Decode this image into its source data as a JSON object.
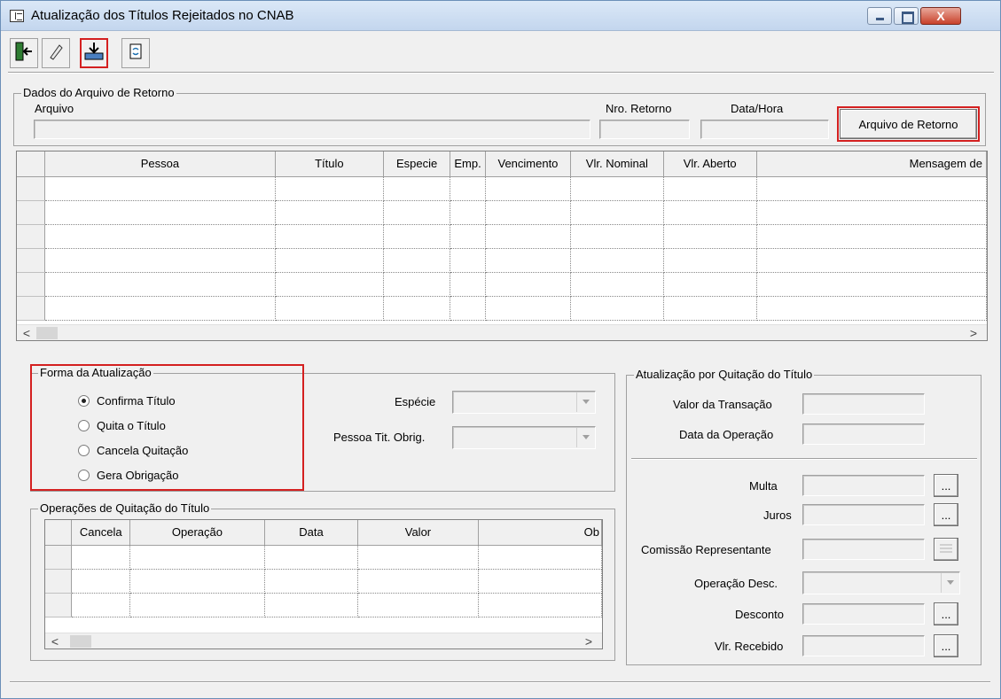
{
  "window": {
    "title": "Atualização dos Títulos Rejeitados no CNAB",
    "close_glyph": "X"
  },
  "toolbar": {
    "buttons": [
      {
        "icon": "exit-door-icon",
        "glyph": "⇤"
      },
      {
        "icon": "eraser-icon",
        "glyph": "✎"
      },
      {
        "icon": "import-file-icon",
        "glyph": "⇩"
      },
      {
        "icon": "refresh-copy-icon",
        "glyph": "⟲"
      }
    ]
  },
  "arquivo_group": {
    "title": "Dados do Arquivo de Retorno",
    "arquivo_label": "Arquivo",
    "nro_retorno_label": "Nro. Retorno",
    "data_hora_label": "Data/Hora",
    "arquivo_button": "Arquivo de Retorno"
  },
  "main_grid": {
    "columns": [
      "Pessoa",
      "Título",
      "Especie",
      "Emp.",
      "Vencimento",
      "Vlr. Nominal",
      "Vlr. Aberto",
      "Mensagem de"
    ]
  },
  "forma_group": {
    "title": "Forma da Atualização",
    "options": [
      {
        "label": "Confirma Título",
        "selected": true
      },
      {
        "label": "Quita o Título",
        "selected": false
      },
      {
        "label": "Cancela Quitação",
        "selected": false
      },
      {
        "label": "Gera Obrigação",
        "selected": false
      }
    ],
    "especie_label": "Espécie",
    "pessoa_label": "Pessoa Tit. Obrig."
  },
  "operacoes_group": {
    "title": "Operações de Quitação do Título",
    "columns": [
      "Cancela",
      "Operação",
      "Data",
      "Valor",
      "Ob"
    ]
  },
  "quitacao_group": {
    "title": "Atualização por Quitação do Título",
    "valor_transacao_label": "Valor da Transação",
    "data_operacao_label": "Data da Operação",
    "multa_label": "Multa",
    "juros_label": "Juros",
    "comissao_label": "Comissão Representante",
    "operacao_desc_label": "Operação Desc.",
    "desconto_label": "Desconto",
    "vlr_recebido_label": "Vlr. Recebido",
    "ellipsis": "..."
  },
  "scroll": {
    "left": "<",
    "right": ">"
  },
  "colors": {
    "highlight": "#d42020",
    "window_bg": "#f0f0f0"
  }
}
